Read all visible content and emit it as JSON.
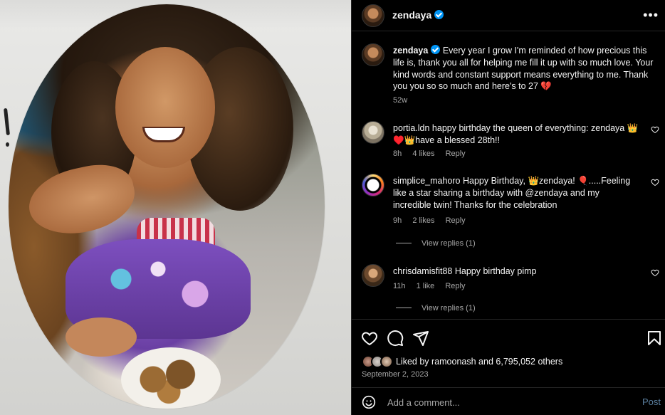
{
  "post": {
    "username": "zendaya",
    "verified": true,
    "caption": "Every year I grow I'm reminded of how precious this life is, thank you all for helping me fill it up with so much love. Your kind words and constant support means everything to me. Thank you you so so much and here's to 27 💔",
    "caption_time": "52w"
  },
  "comments": [
    {
      "username": "portia.ldn",
      "text": "happy birthday the queen of everything: zendaya 👑♥️👑have a blessed 28th!!",
      "time": "8h",
      "likes": "4 likes",
      "reply": "Reply"
    },
    {
      "username": "simplice_mahoro",
      "text": "Happy Birthday, 👑zendaya! 🎈.....Feeling like a star sharing a birthday with @zendaya and my incredible twin! Thanks for the celebration",
      "time": "9h",
      "likes": "2 likes",
      "reply": "Reply",
      "view_replies": "View replies (1)"
    },
    {
      "username": "chrisdamisfit88",
      "text": "Happy birthday pimp",
      "time": "11h",
      "likes": "1 like",
      "reply": "Reply",
      "view_replies": "View replies (1)"
    }
  ],
  "actions": {
    "liked_by_prefix": "Liked by ",
    "liked_by_user": "ramoonash",
    "liked_by_and": " and ",
    "liked_by_others": "6,795,052 others",
    "date": "September 2, 2023"
  },
  "add_comment": {
    "placeholder": "Add a comment...",
    "post_label": "Post"
  },
  "colors": {
    "verified": "#0095f6",
    "background": "#000000",
    "secondary_text": "#a8a8a8",
    "post_button": "#5a7f9f"
  },
  "icons": {
    "header_more": "more-horizontal-icon",
    "like": "heart-icon",
    "comment": "comment-icon",
    "share": "paper-plane-icon",
    "save": "bookmark-icon",
    "emoji": "emoji-icon"
  }
}
